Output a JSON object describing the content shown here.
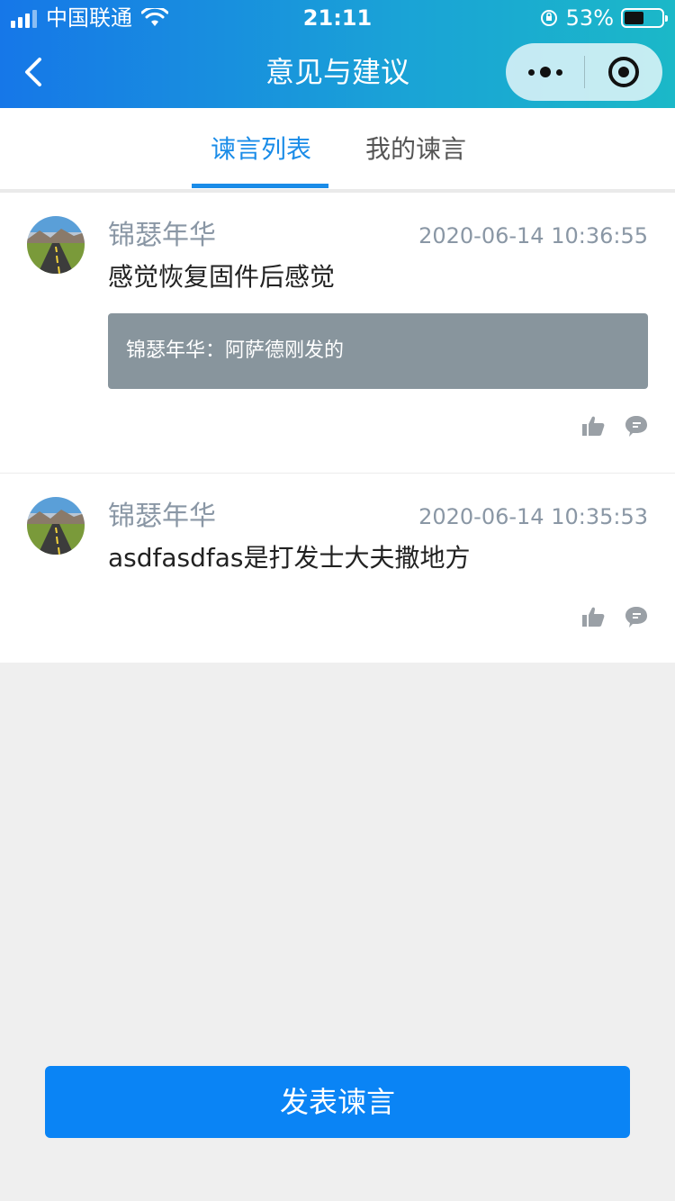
{
  "status_bar": {
    "carrier": "中国联通",
    "time": "21:11",
    "battery_percent": "53%",
    "battery_level": 0.53
  },
  "navbar": {
    "title": "意见与建议",
    "back_icon": "chevron-left-icon",
    "more_icon": "more-dots-icon",
    "close_icon": "record-circle-icon"
  },
  "tabs": [
    {
      "label": "谏言列表",
      "active": true
    },
    {
      "label": "我的谏言",
      "active": false
    }
  ],
  "posts": [
    {
      "username": "锦瑟年华",
      "timestamp": "2020-06-14 10:36:55",
      "content": "感觉恢复固件后感觉",
      "reply": "锦瑟年华：阿萨德刚发的"
    },
    {
      "username": "锦瑟年华",
      "timestamp": "2020-06-14 10:35:53",
      "content": "asdfasdfas是打发士大夫撒地方",
      "reply": ""
    }
  ],
  "action_icons": {
    "like": "thumbs-up-icon",
    "comment": "comment-bubble-icon"
  },
  "footer": {
    "button_label": "发表谏言"
  },
  "colors": {
    "accent": "#1a8ce8",
    "button": "#0a84f5",
    "reply_bg": "#88959d",
    "meta_text": "#8a97a5"
  }
}
